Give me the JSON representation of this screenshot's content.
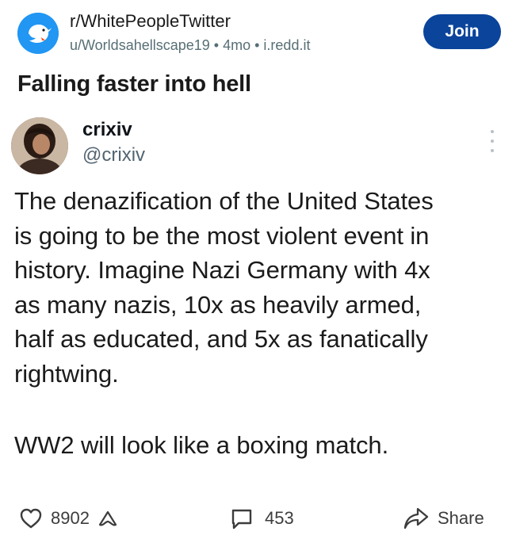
{
  "header": {
    "subreddit": "r/WhitePeopleTwitter",
    "author": "u/Worldsahellscape19",
    "age": "4mo",
    "domain": "i.redd.it",
    "separator": "•",
    "join_label": "Join",
    "join_color": "#0a449b"
  },
  "post": {
    "title": "Falling faster into hell"
  },
  "tweet": {
    "display_name": "crixiv",
    "handle": "@crixiv",
    "lines": [
      "The denazification of the United States",
      "is going to be the most violent event in",
      "history. Imagine  Nazi Germany with 4x",
      "as many nazis, 10x as heavily armed,",
      "half as educated, and 5x as fanatically",
      "rightwing."
    ],
    "last_line": "WW2 will look like a boxing match."
  },
  "actions": {
    "likes": "8902",
    "comments": "453",
    "share_label": "Share"
  }
}
